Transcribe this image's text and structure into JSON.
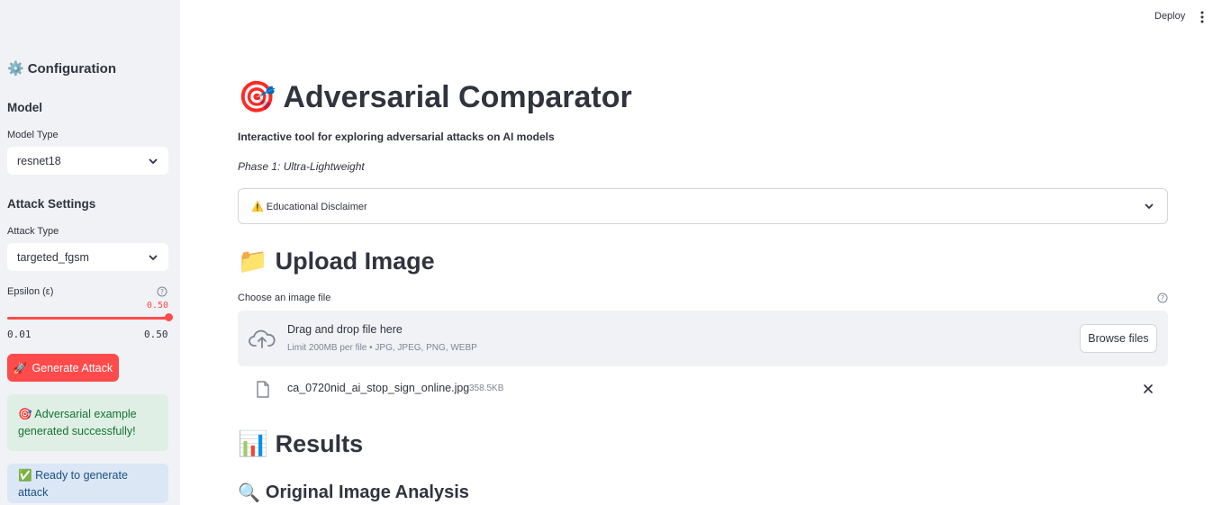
{
  "header": {
    "deploy_label": "Deploy"
  },
  "sidebar": {
    "title": "Configuration",
    "title_icon": "gear-icon",
    "model_heading": "Model",
    "model_type_label": "Model Type",
    "model_type_value": "resnet18",
    "attack_heading": "Attack Settings",
    "attack_type_label": "Attack Type",
    "attack_type_value": "targeted_fgsm",
    "epsilon_label": "Epsilon (ε)",
    "epsilon_value": "0.50",
    "epsilon_min": "0.01",
    "epsilon_max": "0.50",
    "generate_label": "Generate Attack",
    "success_text": "Adversarial example generated successfully!",
    "info_text": "Ready to generate attack"
  },
  "main": {
    "title": "Adversarial Comparator",
    "subtitle": "Interactive tool for exploring adversarial attacks on AI models",
    "phase": "Phase 1: Ultra-Lightweight",
    "disclaimer_label": "Educational Disclaimer",
    "upload_heading": "Upload Image",
    "upload_label": "Choose an image file",
    "dropzone_title": "Drag and drop file here",
    "dropzone_limit": "Limit 200MB per file • JPG, JPEG, PNG, WEBP",
    "browse_label": "Browse files",
    "file_name": "ca_0720nid_ai_stop_sign_online.jpg",
    "file_size": "358.5KB",
    "results_heading": "Results",
    "original_heading": "Original Image Analysis"
  },
  "colors": {
    "accent": "#ff4b4b",
    "sidebar_bg": "#f0f2f6",
    "success_bg": "#dfefe5",
    "success_text": "#177233",
    "info_bg": "#dbe7f5",
    "info_text": "#1c4f85"
  }
}
